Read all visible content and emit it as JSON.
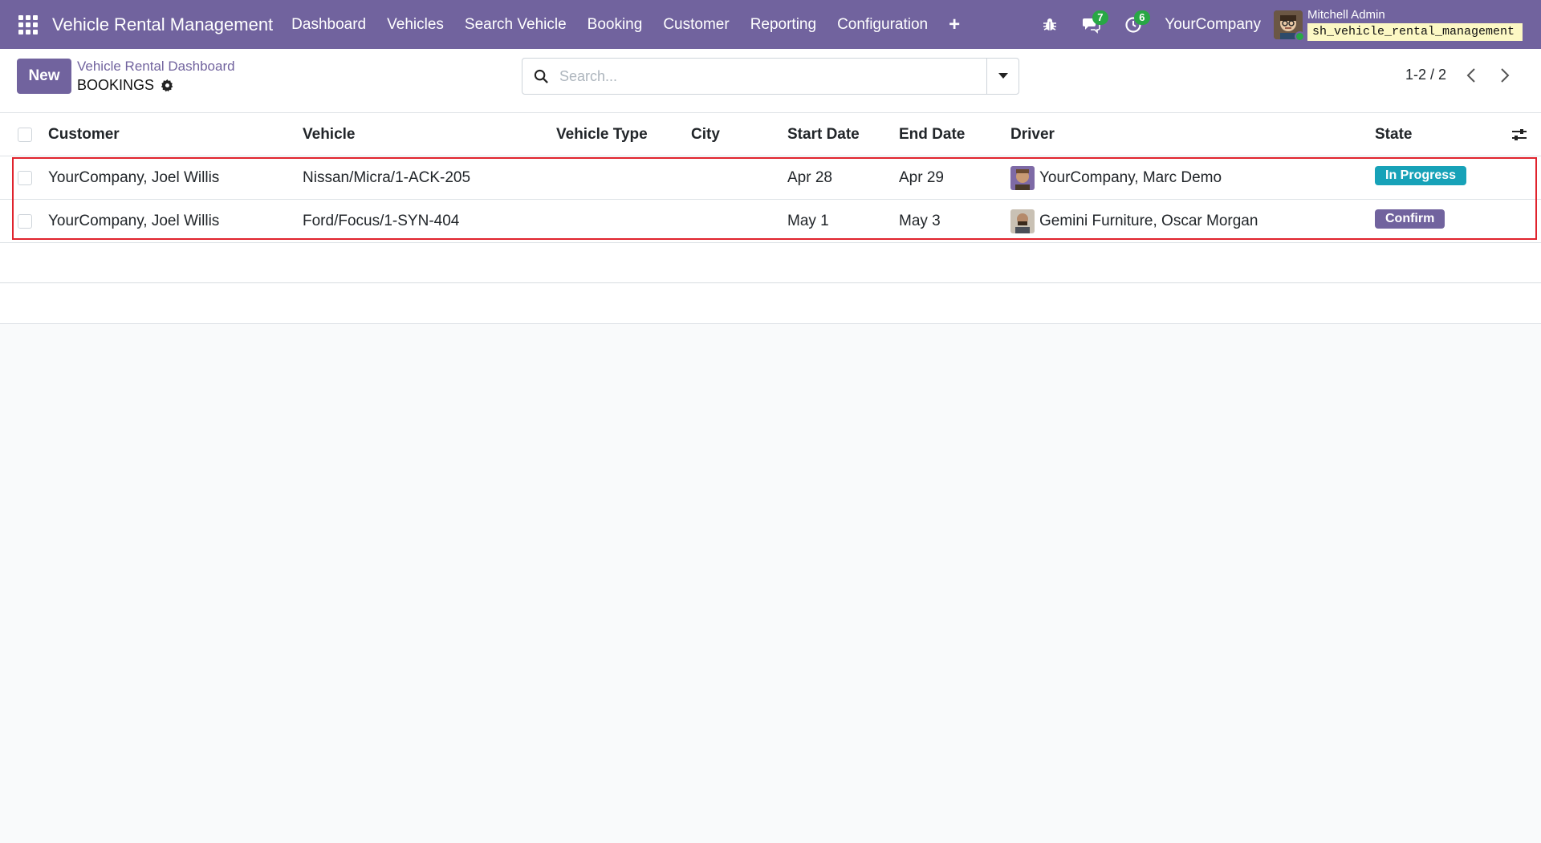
{
  "navbar": {
    "app_title": "Vehicle Rental Management",
    "menu": [
      "Dashboard",
      "Vehicles",
      "Search Vehicle",
      "Booking",
      "Customer",
      "Reporting",
      "Configuration"
    ],
    "messages_count": "7",
    "activities_count": "6",
    "company": "YourCompany",
    "user_name": "Mitchell Admin",
    "db_name": "sh_vehicle_rental_management"
  },
  "control_panel": {
    "new_label": "New",
    "breadcrumb": "Vehicle Rental Dashboard",
    "title": "BOOKINGS",
    "search_placeholder": "Search...",
    "pager": "1-2 / 2"
  },
  "table": {
    "columns": {
      "customer": "Customer",
      "vehicle": "Vehicle",
      "vehicle_type": "Vehicle Type",
      "city": "City",
      "start_date": "Start Date",
      "end_date": "End Date",
      "driver": "Driver",
      "state": "State"
    },
    "rows": [
      {
        "customer": "YourCompany, Joel Willis",
        "vehicle": "Nissan/Micra/1-ACK-205",
        "vehicle_type": "",
        "city": "",
        "start_date": "Apr 28",
        "end_date": "Apr 29",
        "driver": "YourCompany, Marc Demo",
        "state": "In Progress"
      },
      {
        "customer": "YourCompany, Joel Willis",
        "vehicle": "Ford/Focus/1-SYN-404",
        "vehicle_type": "",
        "city": "",
        "start_date": "May 1",
        "end_date": "May 3",
        "driver": "Gemini Furniture, Oscar Morgan",
        "state": "Confirm"
      }
    ]
  },
  "colors": {
    "brand": "#71639e",
    "in_progress": "#17a2b8",
    "confirm": "#71639e",
    "highlight": "#e0232d"
  }
}
